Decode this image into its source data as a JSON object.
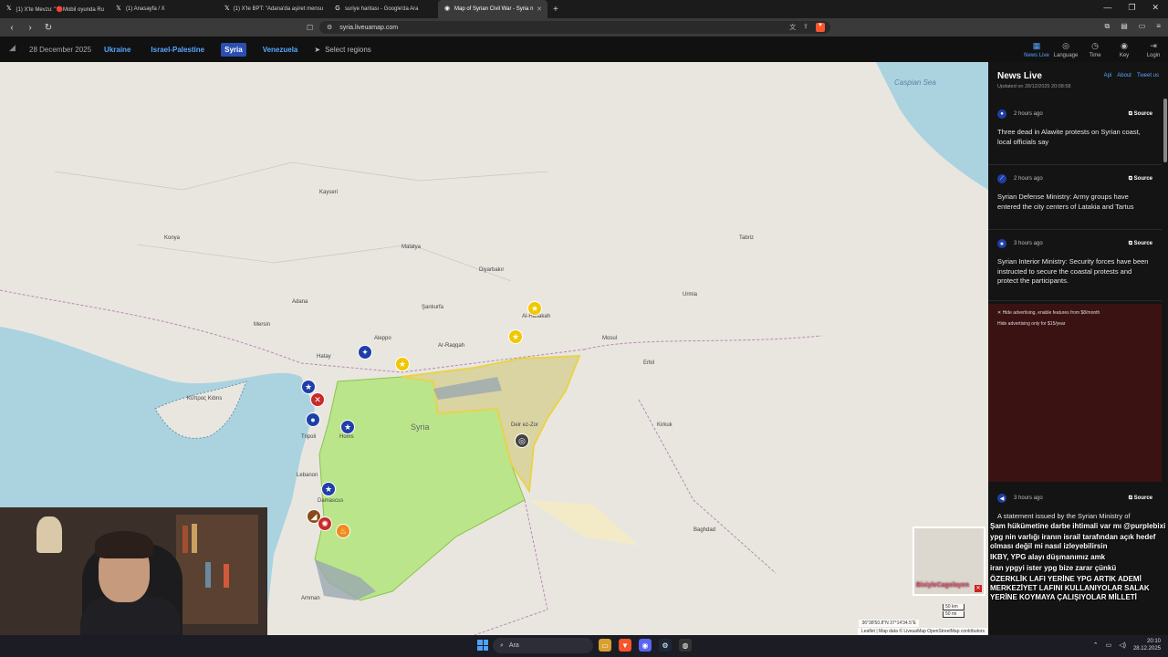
{
  "browser": {
    "tabs": [
      {
        "label": "(1) X'te Mevzu: \"🔴Mobil oyunda Ru",
        "icon": "x-icon",
        "active": false
      },
      {
        "label": "(1) Anasayfa / X",
        "icon": "x-icon",
        "active": false
      },
      {
        "label": "(1) X'te BPT: \"Adana'da aşiret mensu",
        "icon": "x-icon",
        "active": false
      },
      {
        "label": "suriye haritası - Google'da Ara",
        "icon": "google-icon",
        "active": false
      },
      {
        "label": "Map of Syrian Civil War - Syria n",
        "icon": "liveuamap-icon",
        "active": true
      }
    ],
    "url": "syria.liveuamap.com"
  },
  "site": {
    "date": "28 December 2025",
    "regions": [
      "Ukraine",
      "Israel-Palestine",
      "Syria",
      "Venezuela"
    ],
    "active_region": "Syria",
    "select_regions": "Select regions",
    "header_icons": [
      {
        "label": "News Live",
        "icon": "news-icon"
      },
      {
        "label": "Language",
        "icon": "language-icon"
      },
      {
        "label": "Time",
        "icon": "clock-icon"
      },
      {
        "label": "Key",
        "icon": "key-icon"
      },
      {
        "label": "Login",
        "icon": "login-icon"
      }
    ]
  },
  "map": {
    "labels": {
      "caspian": "Caspian Sea",
      "syria": "Syria",
      "damascus": "Damascus",
      "homs": "Homs",
      "aleppo": "Aleppo",
      "hatay": "Hatay",
      "mersin": "Mersin",
      "adana": "Adana",
      "konya": "Konya",
      "kayseri": "Kayseri",
      "malatya": "Malatya",
      "sanliurfa": "Şanlıurfa",
      "diyarbakir": "Diyarbakır",
      "erbil": "Erbil",
      "baghdad": "Baghdad",
      "kibris": "Κύπρος\nKıbrıs",
      "lebanon": "Lebanon",
      "tripoli": "Tripoli",
      "amman": "Amman",
      "kirkuk": "Kirkuk",
      "mosul": "Mosul",
      "urmia": "Urmia",
      "tabriz": "Tabriz",
      "al_hasakah": "Al-Hasakah",
      "raqqa": "Ar-Raqqah",
      "deir": "Deir ez-Zor"
    },
    "attribution": "Leaflet | Map data © LiveuaMap OpenStreetMap contributors",
    "coordinates": "36°38'50.8\"N 37°14'34.5\"E",
    "scale_km": "50 km",
    "scale_mi": "50 mi"
  },
  "news": {
    "title": "News Live",
    "links": [
      "Api",
      "About",
      "Tweet us"
    ],
    "updated": "Updated on 28/12/2025 20:08:58",
    "items": [
      {
        "time": "2 hours ago",
        "source": "Source",
        "text": "Three dead in Alawite protests on Syrian coast, local officials say"
      },
      {
        "time": "2 hours ago",
        "source": "Source",
        "text": "Syrian Defense Ministry: Army groups have entered the city centers of Latakia and Tartus"
      },
      {
        "time": "3 hours ago",
        "source": "Source",
        "text": "Syrian Interior Ministry: Security forces have been instructed to secure the coastal protests and protect the participants."
      },
      {
        "time": "3 hours ago",
        "source": "Source",
        "text": "A statement issued by the Syrian Ministry of"
      }
    ],
    "ad_line1": "✕ Hide advertising, enable features from $8/month",
    "ad_line2": "Hide advertising only for $15/year"
  },
  "chat": [
    {
      "user": "",
      "color": "u-green",
      "text": "Şam hükümetine darbe ihtimali var mı @purplebixi"
    },
    {
      "user": "",
      "color": "u-orange",
      "text": "ypg nin varlığı iranın israil tarafından açık hedef olması değil mi nasıl izleyebilirsin"
    },
    {
      "user": "",
      "color": "u-blue",
      "text": "IKBY, YPG alayı düşmanımız amk"
    },
    {
      "user": "",
      "color": "u-pink",
      "text": "iran ypgyi ister ypg bize zarar çünkü"
    },
    {
      "user": "",
      "color": "u-green",
      "text": "ÖZERKLİK LAFI YERİNE YPG ARTIK ADEMİ MERKEZİYET LAFINI KULLANIYOLAR SALAK YERİNE KOYMAYA ÇALIŞIYOLAR MİLLETİ"
    }
  ],
  "minimap_user": "BixiyleCagolayen",
  "taskbar": {
    "search": "Ara",
    "time": "20:10",
    "date": "28.12.2025"
  }
}
